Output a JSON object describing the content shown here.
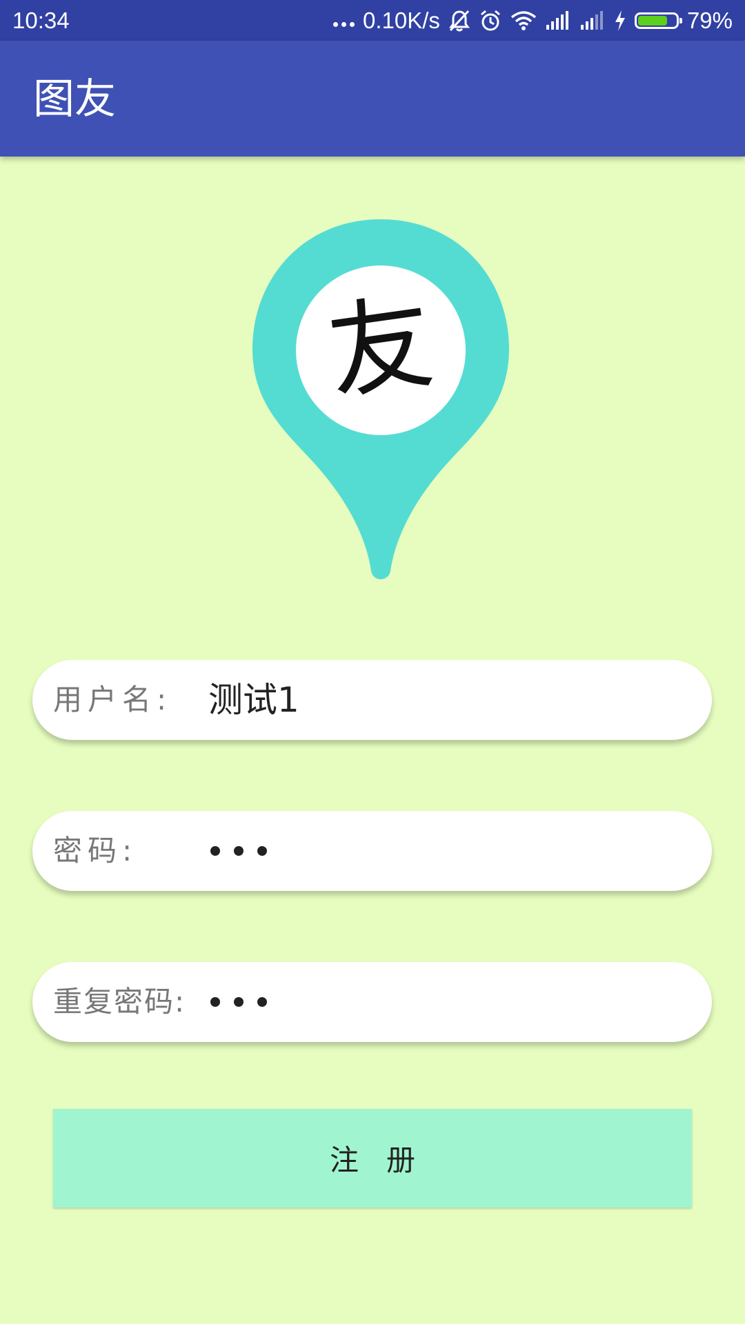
{
  "status_bar": {
    "time": "10:34",
    "network_speed": "0.10K/s",
    "battery_percent": "79%",
    "battery_level": 0.79,
    "icons": [
      "more-dots-icon",
      "mute-icon",
      "alarm-icon",
      "wifi-icon",
      "signal-icon",
      "signal-icon",
      "charging-icon",
      "battery-icon"
    ]
  },
  "app_bar": {
    "title": "图友"
  },
  "logo": {
    "character": "友",
    "pin_color": "#55dcd2",
    "inner_color": "#ffffff"
  },
  "form": {
    "username": {
      "label": "用户名:",
      "value": "测试1"
    },
    "password": {
      "label": "密码:",
      "masked_length": 3
    },
    "repeat_password": {
      "label": "重复密码:",
      "masked_length": 3
    }
  },
  "register_button": {
    "label": "注册"
  },
  "colors": {
    "status_bar": "#3041a3",
    "app_bar": "#3f51b5",
    "background": "#e6fdbf",
    "button": "#a0f5d0"
  }
}
